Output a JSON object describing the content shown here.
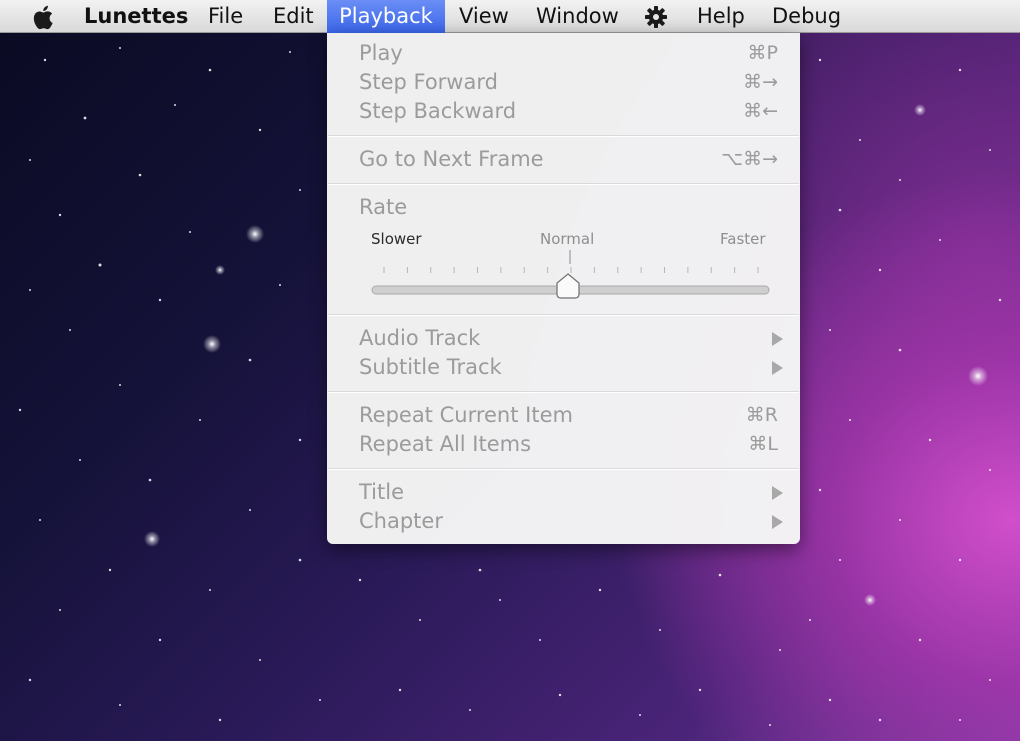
{
  "menubar": {
    "apple_icon": "apple-icon",
    "app_name": "Lunettes",
    "items": [
      "File",
      "Edit",
      "Playback",
      "View",
      "Window"
    ],
    "gear_icon": "gear-icon",
    "help": "Help",
    "debug": "Debug",
    "active_menu": "Playback",
    "active_color": "#3b66ea"
  },
  "playback_menu": {
    "play": {
      "label": "Play",
      "shortcut": "⌘P"
    },
    "step_forward": {
      "label": "Step Forward",
      "shortcut": "⌘→"
    },
    "step_backward": {
      "label": "Step Backward",
      "shortcut": "⌘←"
    },
    "next_frame": {
      "label": "Go to Next Frame",
      "shortcut": "⌥⌘→"
    },
    "rate": {
      "label": "Rate",
      "slower": "Slower",
      "normal": "Normal",
      "faster": "Faster",
      "tick_count": 17,
      "value": 0.5
    },
    "audio_track": {
      "label": "Audio Track",
      "icon": "submenu-arrow-icon"
    },
    "subtitle_track": {
      "label": "Subtitle Track",
      "icon": "submenu-arrow-icon"
    },
    "repeat_current": {
      "label": "Repeat Current Item",
      "shortcut": "⌘R"
    },
    "repeat_all": {
      "label": "Repeat All Items",
      "shortcut": "⌘L"
    },
    "title": {
      "label": "Title",
      "icon": "submenu-arrow-icon"
    },
    "chapter": {
      "label": "Chapter",
      "icon": "submenu-arrow-icon"
    }
  }
}
